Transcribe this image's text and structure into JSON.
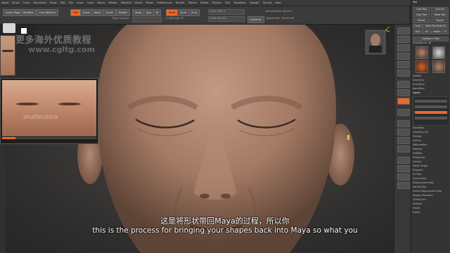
{
  "menubar": {
    "items": [
      "Alpha",
      "Brush",
      "Color",
      "Document",
      "Draw",
      "Edit",
      "File",
      "Layer",
      "Light",
      "Macro",
      "Marker",
      "Material",
      "Movie",
      "Picker",
      "Preferences",
      "Render",
      "Stencil",
      "Stroke",
      "Texture",
      "Tool",
      "Transform",
      "Zplugin",
      "Zscript",
      "Help"
    ],
    "title": "ZBrush 4R7 P3 · Free Mem 2.33GB · Active Mem 1172 · Scratch Disk 48 · Timer: 0.001 · PolyCount: 6.8 MP · MeshCount: 1"
  },
  "toolbar": {
    "home_page": "Home Page",
    "lightbox": "LightBox",
    "live_boolean": "Live Boolean",
    "edit": "Edit",
    "draw": "Draw",
    "move": "Move",
    "scale": "Scale",
    "rotate": "Rotate",
    "mrgb": "Mrgb",
    "rgb": "Rgb",
    "m": "M",
    "zadd": "Zadd",
    "zsub": "Zsub",
    "zcut": "Zcut",
    "rgb_intensity": "Rgb Intensity",
    "z_intensity": "Z Intensity 25",
    "focal_shift": "Focal Shift 0",
    "draw_size": "Draw Size 64",
    "dynamic": "Dynamic",
    "active_points": "ActivePoints: 66,443",
    "total_points": "TotalPoints: 16,653 Mil"
  },
  "right_dock": {
    "header": "Tool",
    "buttons": [
      "Load Tool",
      "Save As",
      "Copy Tool",
      "Paste Tool",
      "Import",
      "Export",
      "Clone",
      "Make PolyMesh3D",
      "GoZ",
      "All",
      "Visible",
      "R",
      "Lightbox ▸ Tools"
    ],
    "tool_label": "SimpleBrush: 48",
    "sections": [
      "Subtool",
      "Geometry",
      "ArrayMesh",
      "NanoMesh",
      "Layers",
      "FiberMesh",
      "Geometry HD",
      "Preview",
      "Surface",
      "Deformation",
      "Masking",
      "Visibility",
      "Polygroups",
      "Contact",
      "Morph Target",
      "Polypaint",
      "UV Map",
      "Texture Map",
      "Displacement Map",
      "Normal Map",
      "Vector Displacement Map",
      "Display Properties",
      "Unified Skin",
      "Initialize",
      "Import",
      "Export"
    ]
  },
  "watermark": {
    "text": "更多海外优质教程",
    "url": "www.cgltg.com",
    "stock": "shutterstock"
  },
  "subtitles": {
    "chinese": "这是将形状带回Maya的过程，所以你",
    "english": "this is the process for bringing your shapes back into Maya so what you"
  },
  "colors": {
    "ui_bg": "#3b3b3b",
    "viewport_bg": "#2f2e2d",
    "skin": "#b08670",
    "accent_orange": "#e8692a"
  }
}
